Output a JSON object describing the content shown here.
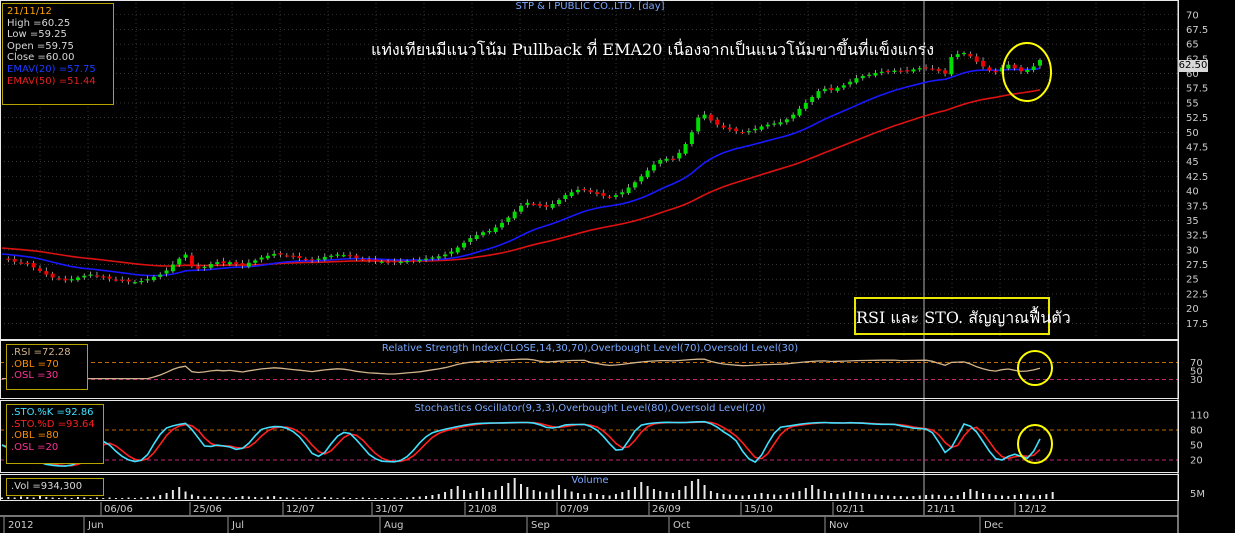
{
  "window": {
    "title": "STP & I PUBLIC CO.,LTD. [day]"
  },
  "info_box": {
    "date": "21/11/12",
    "lines": [
      {
        "label": "High",
        "value": "=60.25",
        "color": "#d8d8d8"
      },
      {
        "label": "Low",
        "value": "=59.25",
        "color": "#d8d8d8"
      },
      {
        "label": "Open",
        "value": "=59.75",
        "color": "#d8d8d8"
      },
      {
        "label": "Close",
        "value": "=60.00",
        "color": "#d8d8d8"
      },
      {
        "label": "EMAV(20)",
        "value": "=57.75",
        "color": "#1d3bff"
      },
      {
        "label": "EMAV(50)",
        "value": "=51.44",
        "color": "#e02020"
      }
    ]
  },
  "annotations": {
    "pullback": "แท่งเทียนมีแนวโน้ม Pullback ที่ EMA20 เนื่องจากเป็นแนวโน้มขาขึ้นที่แข็งแกร่ง",
    "rsi_sto": "RSI และ STO. สัญญาณฟื้นตัว"
  },
  "rsi_box": {
    "lines": [
      {
        "label": ".RSI",
        "value": "=72.28",
        "color": "#d2b48c"
      },
      {
        "label": ".OBL",
        "value": "=70",
        "color": "#ff8c00"
      },
      {
        "label": ".OSL",
        "value": "=30",
        "color": "#ff3399"
      }
    ]
  },
  "sto_box": {
    "lines": [
      {
        "label": ".STO.%K",
        "value": "=92.86",
        "color": "#40e0ff"
      },
      {
        "label": ".STO.%D",
        "value": "=93.64",
        "color": "#ff2020"
      },
      {
        "label": ".OBL",
        "value": "=80",
        "color": "#ff8c00"
      },
      {
        "label": ".OSL",
        "value": "=20",
        "color": "#ff3399"
      }
    ]
  },
  "vol_box": {
    "label": ".Vol",
    "value": "=934,300"
  },
  "colors": {
    "up": "#00dd00",
    "down": "#ee0000",
    "ema20": "#1818ff",
    "ema50": "#dd1111",
    "grid": "#555555",
    "axis_text": "#cccccc",
    "title": "#7aa8ff",
    "circle": "#ffff00"
  },
  "chart_data": [
    {
      "type": "candlestick",
      "title": "STP & I PUBLIC CO.,LTD. [day]",
      "y_ticks": [
        "70",
        "67.5",
        "65",
        "62.5",
        "60",
        "57.5",
        "55",
        "52.5",
        "50",
        "47.5",
        "45",
        "42.5",
        "40",
        "37.5",
        "35",
        "32.5",
        "30",
        "27.5",
        "25",
        "22.5",
        "20",
        "17.5"
      ],
      "ylim": [
        15,
        72
      ],
      "last_price_label": "62.50",
      "series": [
        {
          "name": "EMAV(20)",
          "last": 57.75
        },
        {
          "name": "EMAV(50)",
          "last": 51.44
        }
      ],
      "close": [
        28.5,
        28.3,
        28,
        27.8,
        27.6,
        27,
        26.4,
        25.8,
        25.3,
        25.1,
        24.8,
        25,
        25.3,
        25.6,
        25.8,
        25.5,
        25.3,
        25.1,
        24.9,
        24.8,
        24.6,
        24.5,
        24.7,
        25,
        25.4,
        25.8,
        26.5,
        27.5,
        28.5,
        29.2,
        27.2,
        26.8,
        27.1,
        27.6,
        27.9,
        27.7,
        27.9,
        27.6,
        27.3,
        27.8,
        28.2,
        28.7,
        29,
        29.3,
        29.2,
        29,
        28.8,
        28.6,
        28.4,
        28.2,
        28.5,
        28.8,
        29,
        29.2,
        29.1,
        28.9,
        28.6,
        28.4,
        28.2,
        28.1,
        28,
        27.9,
        27.9,
        28,
        28.1,
        28.2,
        28.3,
        28.5,
        28.7,
        28.9,
        29.2,
        29.7,
        30.4,
        31.2,
        32,
        32.5,
        33,
        33.2,
        33.8,
        34.6,
        35.5,
        36.5,
        37.5,
        38,
        37.8,
        37.5,
        37.3,
        37.8,
        38.5,
        39.3,
        39.8,
        40.2,
        40.3,
        39.8,
        39.5,
        39.2,
        39,
        39.3,
        39.8,
        40.6,
        41.5,
        42.5,
        43.5,
        44.5,
        45.3,
        45.5,
        45.4,
        46.5,
        48,
        50,
        52.5,
        53,
        52,
        51.3,
        50.8,
        50.5,
        50.2,
        50,
        50.2,
        50.6,
        51,
        51.3,
        51.5,
        51.7,
        52.2,
        53,
        54,
        55,
        56,
        57,
        57.4,
        57.2,
        57.6,
        58,
        58.6,
        59.2,
        59.6,
        59.8,
        60.1,
        60.3,
        60.4,
        60.5,
        60.4,
        60.5,
        60.7,
        60.9,
        61,
        60.8,
        60.4,
        60,
        62.8,
        63.3,
        63.5,
        62.9,
        62,
        61.2,
        60.5,
        60.2,
        61,
        61.5,
        60.9,
        60.4,
        60.6,
        61.2,
        62.3
      ],
      "volume": [
        0.3,
        0.4,
        0.3,
        0.5,
        0.4,
        0.3,
        0.6,
        0.4,
        0.3,
        0.2,
        0.3,
        0.2,
        0.4,
        0.3,
        0.2,
        0.3,
        0.2,
        0.3,
        0.2,
        0.2,
        0.3,
        0.2,
        0.3,
        0.4,
        0.5,
        0.8,
        1.2,
        1.8,
        2.4,
        1.5,
        0.9,
        0.6,
        0.5,
        0.4,
        0.5,
        0.4,
        0.3,
        0.4,
        0.6,
        0.5,
        0.4,
        0.3,
        0.5,
        0.6,
        0.4,
        0.3,
        0.3,
        0.2,
        0.3,
        0.2,
        0.3,
        0.4,
        0.3,
        0.2,
        0.3,
        0.2,
        0.2,
        0.3,
        0.2,
        0.2,
        0.2,
        0.2,
        0.3,
        0.2,
        0.3,
        0.4,
        0.5,
        0.6,
        0.8,
        1.0,
        1.4,
        2.0,
        2.6,
        1.8,
        1.2,
        1.6,
        2.2,
        1.4,
        1.8,
        2.6,
        3.2,
        4.2,
        3.0,
        2.4,
        1.8,
        1.5,
        1.3,
        1.9,
        2.8,
        2.0,
        1.5,
        1.2,
        1.0,
        1.2,
        1.0,
        0.8,
        0.7,
        1.0,
        1.4,
        1.8,
        2.4,
        3.4,
        2.6,
        2.0,
        1.6,
        1.4,
        1.2,
        1.8,
        2.6,
        3.6,
        4.0,
        2.8,
        1.6,
        1.2,
        1.0,
        0.9,
        0.8,
        0.7,
        0.8,
        1.0,
        1.2,
        1.0,
        0.9,
        0.8,
        1.0,
        1.3,
        1.6,
        2.2,
        2.8,
        2.0,
        1.6,
        1.2,
        1.0,
        1.3,
        1.6,
        1.4,
        1.2,
        1.0,
        0.9,
        0.8,
        0.7,
        0.6,
        0.6,
        0.5,
        0.6,
        0.7,
        0.8,
        0.9,
        0.8,
        0.7,
        0.6,
        0.8,
        1.4,
        2.0,
        1.6,
        1.2,
        1.0,
        0.8,
        0.7,
        0.6,
        0.8,
        1.0,
        0.9,
        0.7,
        0.8,
        1.0,
        1.4
      ]
    },
    {
      "type": "line",
      "title": "Relative Strength Index(CLOSE,14,30,70),Overbought Level(70),Oversold Level(30)",
      "y_ticks": [
        "70",
        "50",
        "30"
      ],
      "ylim": [
        0,
        100
      ],
      "levels": [
        70,
        30
      ],
      "series": [
        {
          "name": ".RSI",
          "last": 72.28
        }
      ]
    },
    {
      "type": "line",
      "title": "Stochastics Oscillator(9,3,3),Overbought Level(80),Oversold Level(20)",
      "y_ticks": [
        "110",
        "80",
        "50",
        "20"
      ],
      "ylim": [
        0,
        120
      ],
      "levels": [
        80,
        20
      ],
      "series": [
        {
          "name": ".STO.%K",
          "last": 92.86
        },
        {
          "name": ".STO.%D",
          "last": 93.64
        }
      ]
    },
    {
      "type": "bar",
      "title": "Volume",
      "y_ticks": [
        "5M"
      ],
      "series": [
        {
          "name": ".Vol",
          "last": 934300
        }
      ]
    }
  ],
  "x_axis": {
    "top_labels": [
      "06/06",
      "25/06",
      "12/07",
      "31/07",
      "21/08",
      "07/09",
      "26/09",
      "15/10",
      "02/11",
      "21/11",
      "12/12"
    ],
    "bottom_labels": [
      "2012",
      "Jun",
      "Jul",
      "Aug",
      "Sep",
      "Oct",
      "Nov",
      "Dec"
    ]
  }
}
